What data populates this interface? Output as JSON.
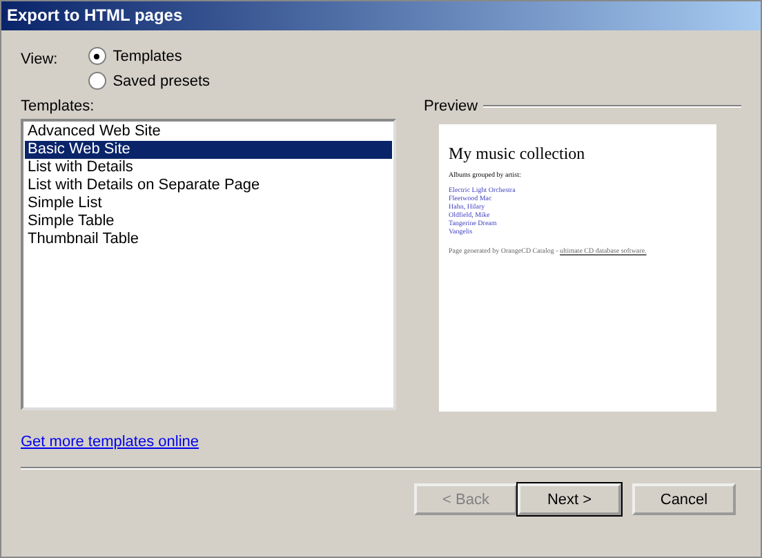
{
  "window": {
    "title": "Export to HTML pages"
  },
  "view": {
    "label": "View:",
    "options": [
      {
        "label": "Templates",
        "selected": true
      },
      {
        "label": "Saved presets",
        "selected": false
      }
    ]
  },
  "templates": {
    "label": "Templates:",
    "items": [
      {
        "label": "Advanced Web Site",
        "selected": false
      },
      {
        "label": "Basic Web Site",
        "selected": true
      },
      {
        "label": "List with Details",
        "selected": false
      },
      {
        "label": "List with Details on Separate Page",
        "selected": false
      },
      {
        "label": "Simple List",
        "selected": false
      },
      {
        "label": "Simple Table",
        "selected": false
      },
      {
        "label": "Thumbnail Table",
        "selected": false
      }
    ]
  },
  "preview": {
    "label": "Preview",
    "heading": "My music collection",
    "subtitle": "Albums grouped by artist:",
    "links": [
      "Electric Light Orchestra",
      "Fleetwood Mac",
      "Hahn, Hilary",
      "Oldfield, Mike",
      "Tangerine Dream",
      "Vangelis"
    ],
    "footer": "Page generated by OrangeCD Catalog - ",
    "footer_link": "ultimate CD database software."
  },
  "link": "Get more templates online",
  "buttons": [
    {
      "label": "< Back",
      "disabled": true,
      "default": false
    },
    {
      "label": "Next >",
      "disabled": false,
      "default": true
    },
    {
      "label": "Cancel",
      "disabled": false,
      "default": false
    }
  ]
}
